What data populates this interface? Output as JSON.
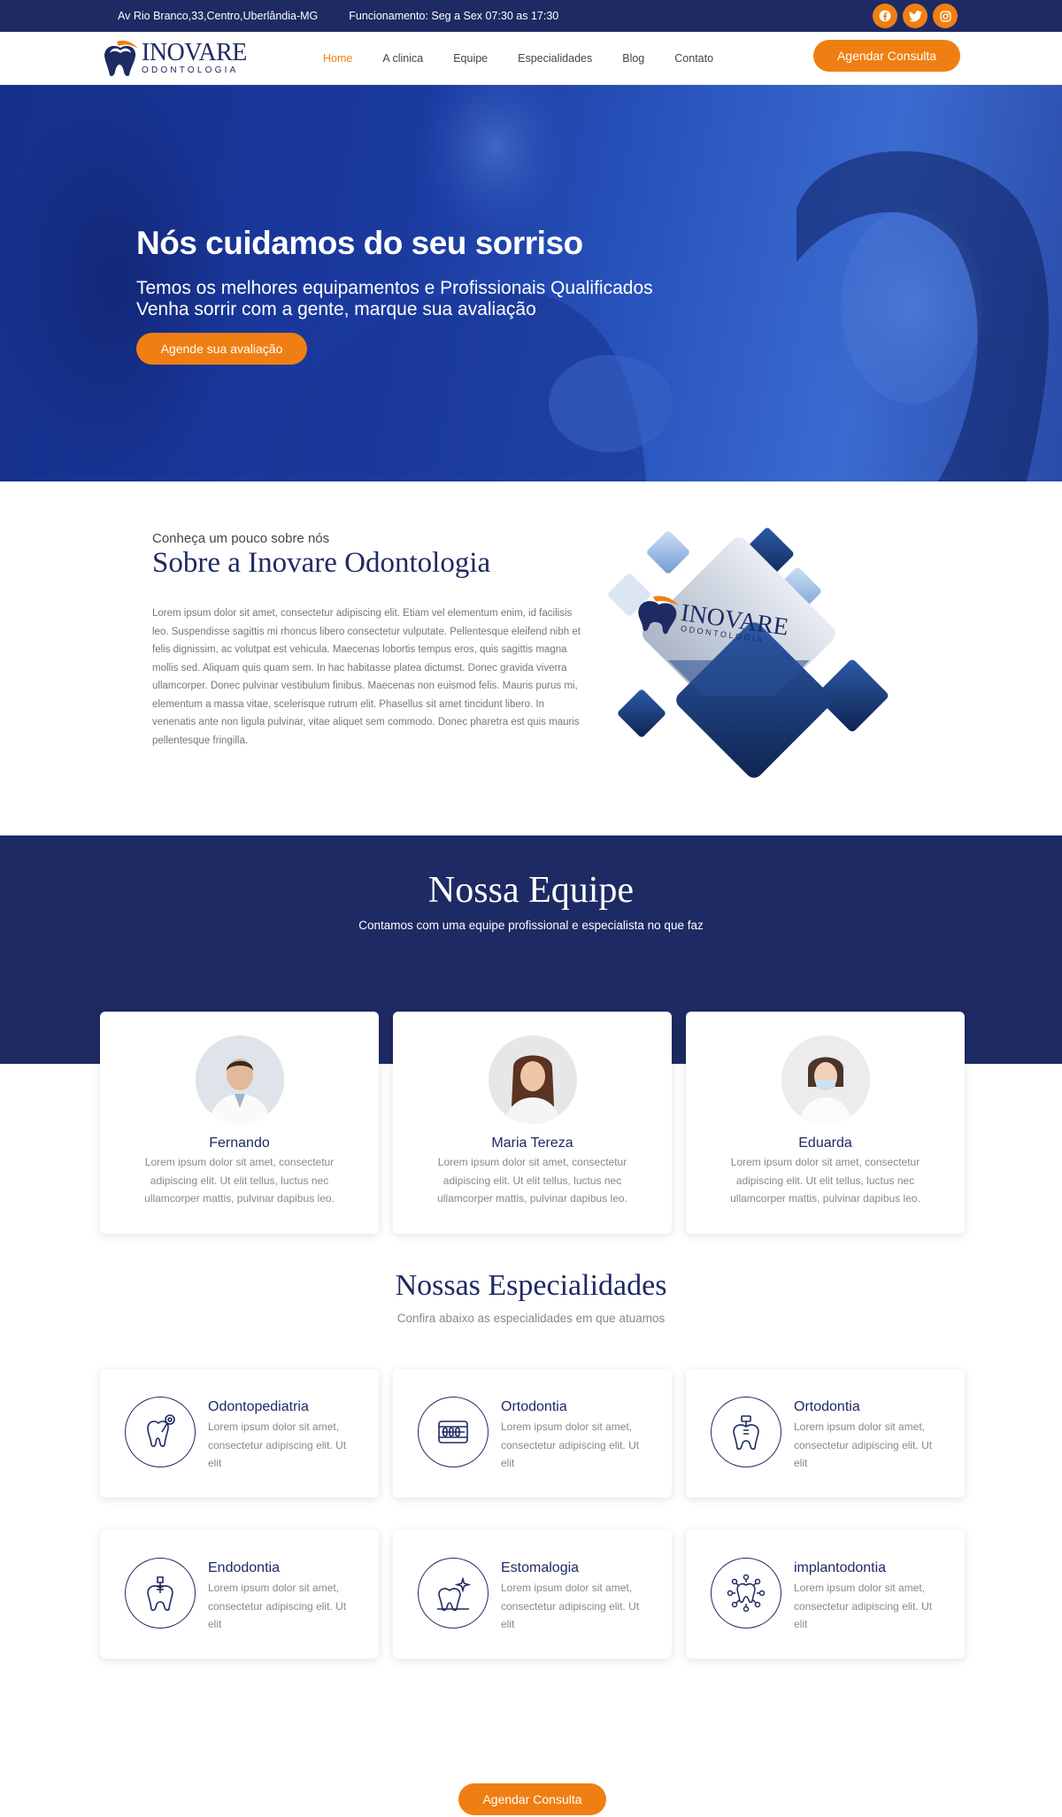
{
  "topbar": {
    "address": "Av Rio Branco,33,Centro,Uberlândia-MG",
    "hours": "Funcionamento: Seg a Sex 07:30 as 17:30",
    "social": [
      "facebook-icon",
      "twitter-icon",
      "instagram-icon"
    ]
  },
  "brand": {
    "name": "INOVARE",
    "sub": "ODONTOLOGIA"
  },
  "nav": {
    "items": [
      {
        "label": "Home",
        "active": true
      },
      {
        "label": "A clinica"
      },
      {
        "label": "Equipe"
      },
      {
        "label": "Especialidades"
      },
      {
        "label": "Blog"
      },
      {
        "label": "Contato"
      }
    ],
    "cta": "Agendar Consulta"
  },
  "hero": {
    "title": "Nós cuidamos do seu sorriso",
    "line1": "Temos os melhores equipamentos e Profissionais Qualificados",
    "line2": "Venha sorrir com a gente, marque sua avaliação",
    "cta": "Agende sua avaliação"
  },
  "about": {
    "kicker": "Conheça um pouco sobre nós",
    "title": "Sobre a Inovare Odontologia",
    "body": "Lorem ipsum dolor sit amet, consectetur adipiscing elit. Etiam vel elementum enim, id facilisis leo. Suspendisse sagittis mi rhoncus libero consectetur vulputate. Pellentesque eleifend nibh et felis dignissim, ac volutpat est vehicula. Maecenas lobortis tempus eros, quis sagittis magna mollis sed. Aliquam quis quam sem. In hac habitasse platea dictumst. Donec gravida viverra ullamcorper. Donec pulvinar vestibulum finibus. Maecenas non euismod felis. Mauris purus mi, elementum a massa vitae, scelerisque rutrum elit. Phasellus sit amet tincidunt libero. In venenatis ante non ligula pulvinar, vitae aliquet sem commodo. Donec pharetra est quis mauris pellentesque fringilla.",
    "collage_sign": "INOVARE",
    "collage_sign_sub": "ODONTOLOGIA"
  },
  "team": {
    "title": "Nossa Equipe",
    "subtitle": "Contamos com uma equipe profissional e especialista no que faz",
    "members": [
      {
        "name": "Fernando",
        "desc": "Lorem ipsum dolor sit amet, consectetur adipiscing elit. Ut elit tellus, luctus nec ullamcorper mattis, pulvinar dapibus leo."
      },
      {
        "name": "Maria Tereza",
        "desc": "Lorem ipsum dolor sit amet, consectetur adipiscing elit. Ut elit tellus, luctus nec ullamcorper mattis, pulvinar dapibus leo."
      },
      {
        "name": "Eduarda",
        "desc": "Lorem ipsum dolor sit amet, consectetur adipiscing elit. Ut elit tellus, luctus nec ullamcorper mattis, pulvinar dapibus leo."
      }
    ]
  },
  "specialties": {
    "title": "Nossas Especialidades",
    "subtitle": "Confira abaixo as especialidades em que atuamos",
    "items": [
      {
        "title": "Odontopediatria",
        "desc": "Lorem ipsum dolor sit amet, consectetur adipiscing elit. Ut elit",
        "icon": "child-tooth-icon"
      },
      {
        "title": "Ortodontia",
        "desc": "Lorem ipsum dolor sit amet, consectetur adipiscing elit. Ut elit",
        "icon": "braces-icon"
      },
      {
        "title": "Ortodontia",
        "desc": "Lorem ipsum dolor sit amet, consectetur adipiscing elit. Ut elit",
        "icon": "tooth-implant-icon"
      },
      {
        "title": "Endodontia",
        "desc": "Lorem ipsum dolor sit amet, consectetur adipiscing elit. Ut elit",
        "icon": "tooth-root-icon"
      },
      {
        "title": "Estomalogia",
        "desc": "Lorem ipsum dolor sit amet, consectetur adipiscing elit. Ut elit",
        "icon": "shining-tooth-icon"
      },
      {
        "title": "implantodontia",
        "desc": "Lorem ipsum dolor sit amet, consectetur adipiscing elit. Ut elit",
        "icon": "tooth-network-icon"
      }
    ],
    "cta": "Agendar Consulta"
  },
  "colors": {
    "navy": "#1e2a63",
    "orange": "#f07f13",
    "hero_blue": "#1b3aa0"
  }
}
